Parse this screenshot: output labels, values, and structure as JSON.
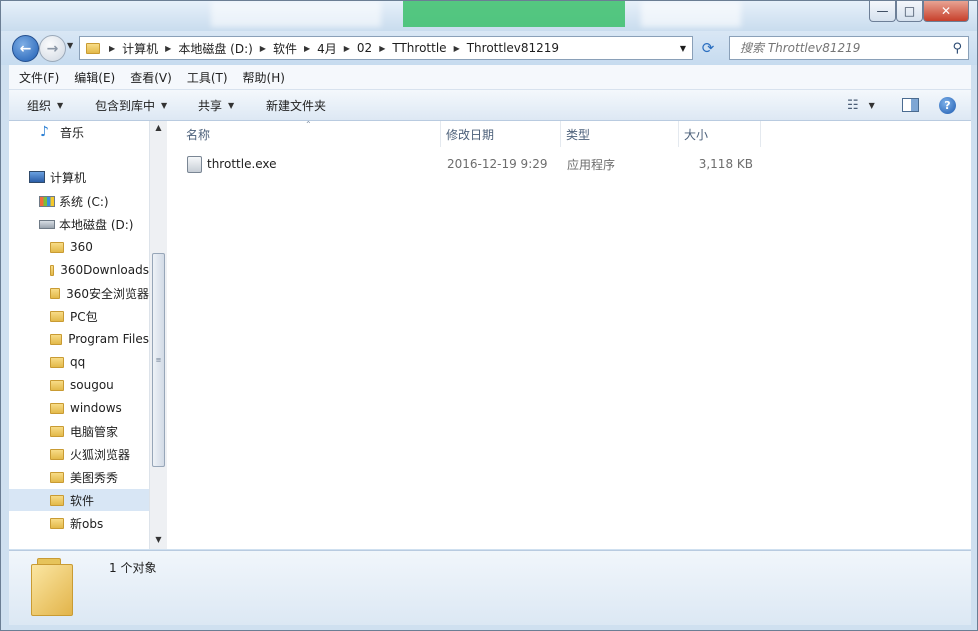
{
  "address": {
    "breadcrumbs": [
      "计算机",
      "本地磁盘 (D:)",
      "软件",
      "4月",
      "02",
      "TThrottle",
      "Throttlev81219"
    ]
  },
  "search": {
    "placeholder": "搜索 Throttlev81219"
  },
  "menu": [
    "文件(F)",
    "编辑(E)",
    "查看(V)",
    "工具(T)",
    "帮助(H)"
  ],
  "toolbar": {
    "organize": "组织",
    "include_library": "包含到库中",
    "share": "共享",
    "new_folder": "新建文件夹"
  },
  "nav": {
    "music": "音乐",
    "computer": "计算机",
    "drive_c": "系统 (C:)",
    "drive_d": "本地磁盘 (D:)",
    "folders": [
      "360",
      "360Downloads",
      "360安全浏览器",
      "PC包",
      "Program Files",
      "qq",
      "sougou",
      "windows",
      "电脑管家",
      "火狐浏览器",
      "美图秀秀",
      "软件",
      "新obs"
    ],
    "selected": "软件"
  },
  "columns": {
    "name": "名称",
    "modified": "修改日期",
    "type": "类型",
    "size": "大小"
  },
  "files": [
    {
      "name": "throttle.exe",
      "modified": "2016-12-19 9:29",
      "type": "应用程序",
      "size": "3,118 KB"
    }
  ],
  "status": {
    "count": "1 个对象"
  },
  "icons": {
    "back": "back-arrow-icon",
    "forward": "forward-arrow-icon",
    "refresh": "refresh-icon",
    "search": "search-icon",
    "view": "view-options-icon",
    "preview": "preview-pane-icon",
    "help": "help-icon"
  },
  "colors": {
    "accent": "#2b6fc0",
    "selected_bg": "#d8e6f5",
    "frame": "#c6dbef"
  }
}
